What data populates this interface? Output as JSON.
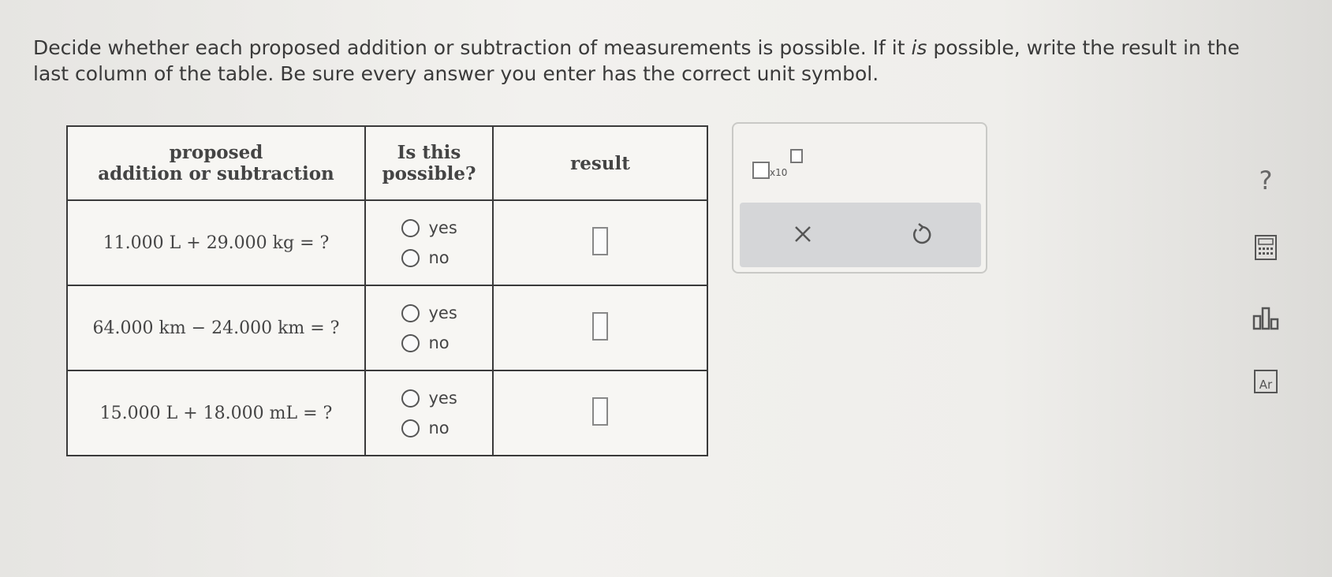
{
  "instructions": {
    "part1": "Decide whether each proposed addition or subtraction of measurements is possible. If it ",
    "emphasis": "is",
    "part2": " possible, write the result in the last column of the table. Be sure every answer you enter has the correct unit symbol."
  },
  "table": {
    "headers": {
      "col1_line1": "proposed",
      "col1_line2": "addition or subtraction",
      "col2_line1": "Is this",
      "col2_line2": "possible?",
      "col3": "result"
    },
    "rows": [
      {
        "expression": "11.000 L + 29.000 kg = ?",
        "option_yes": "yes",
        "option_no": "no"
      },
      {
        "expression": "64.000 km − 24.000 km = ?",
        "option_yes": "yes",
        "option_no": "no"
      },
      {
        "expression": "15.000 L + 18.000 mL = ?",
        "option_yes": "yes",
        "option_no": "no"
      }
    ]
  },
  "toolbox": {
    "scientific_notation": {
      "multiplier": "x10",
      "icon": "scientific-notation-icon"
    },
    "clear_icon": "close-icon",
    "undo_icon": "undo-icon"
  },
  "side_tools": {
    "help": "?",
    "calculator_icon": "calculator-icon",
    "data_icon": "bar-chart-icon",
    "periodic_table": "Ar"
  },
  "colors": {
    "background": "#ecebe8",
    "action_bar": "#d5d6d8",
    "text": "#3a3a3a"
  }
}
